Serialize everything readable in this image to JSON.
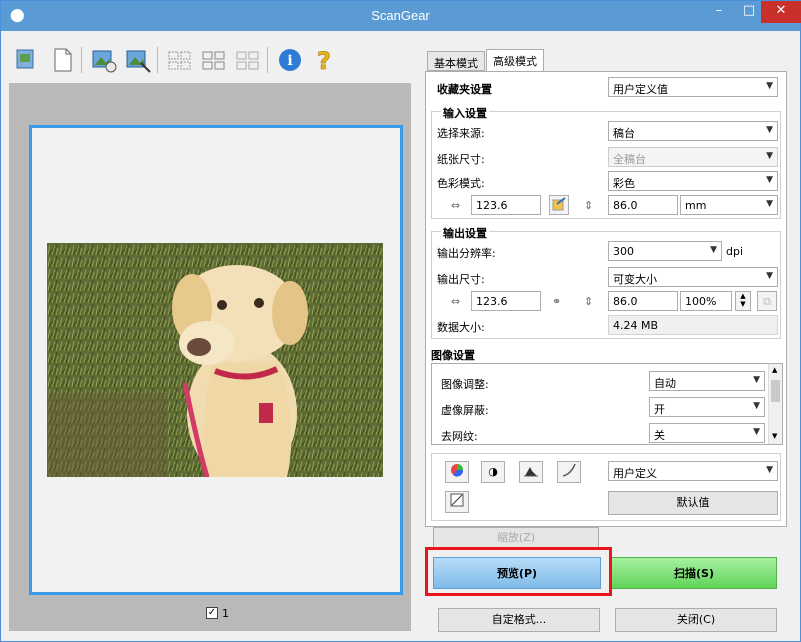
{
  "window": {
    "title": "ScanGear",
    "min": "–",
    "max": "□",
    "close": "✕"
  },
  "toolbar": {
    "items": [
      "thumbnail-view",
      "whole-image",
      "crop-auto",
      "crop-manual",
      "layout-1",
      "layout-2",
      "layout-3",
      "info",
      "help"
    ]
  },
  "preview": {
    "thumb_checked": "✓",
    "thumb_number": "1"
  },
  "tabs": [
    {
      "label": "基本模式"
    },
    {
      "label": "高级模式"
    }
  ],
  "favorites": {
    "label": "收藏夹设置",
    "value": "用户定义值"
  },
  "input": {
    "header": "输入设置",
    "source_label": "选择来源:",
    "source_value": "稿台",
    "paper_label": "纸张尺寸:",
    "paper_value": "全稿台",
    "color_label": "色彩模式:",
    "color_value": "彩色",
    "width": "123.6",
    "height": "86.0",
    "unit": "mm"
  },
  "output": {
    "header": "输出设置",
    "resolution_label": "输出分辨率:",
    "resolution_value": "300",
    "resolution_unit": "dpi",
    "size_label": "输出尺寸:",
    "size_value": "可变大小",
    "width": "123.6",
    "height": "86.0",
    "scale": "100%",
    "data_size_label": "数据大小:",
    "data_size_value": "4.24 MB"
  },
  "image_settings": {
    "header": "图像设置",
    "rows": [
      {
        "label": "图像调整:",
        "value": "自动"
      },
      {
        "label": "虚像屏蔽:",
        "value": "开"
      },
      {
        "label": "去网纹:",
        "value": "关"
      }
    ]
  },
  "color_adjust": {
    "preset": "用户定义",
    "defaults_label": "默认值"
  },
  "buttons": {
    "zoom": "缩放(Z)",
    "preview": "预览(P)",
    "scan": "扫描(S)",
    "custom": "自定格式...",
    "close": "关闭(C)"
  },
  "colors": {
    "titlebar": "#5b9bd5",
    "highlight": "#e8151c",
    "frame": "#3b9be8"
  }
}
